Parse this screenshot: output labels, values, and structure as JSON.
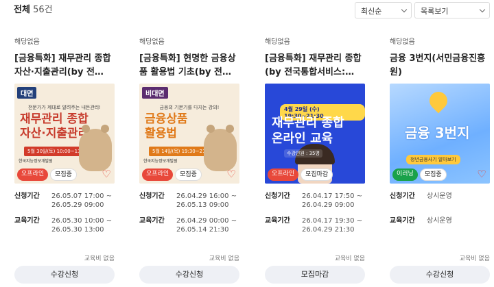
{
  "header": {
    "total_label": "전체",
    "total_count": "56건",
    "sort_select": "최신순",
    "view_select": "목록보기"
  },
  "cards": [
    {
      "status": "해당없음",
      "title": "[금융특화] 재무관리 종합 자산·지출관리(by 전…",
      "thumb": {
        "tag": "대면",
        "subtitle": "전문가가 제대로 알려주는 내돈관리!",
        "headline_1": "재무관리 종합",
        "headline_2": "자산·지출관리",
        "date": "5월 30일(토) 10:00~13:00",
        "logos": "한국지능정보개발원"
      },
      "pills": [
        "오프라인",
        "모집중"
      ],
      "apply_period_label": "신청기간",
      "apply_period": [
        "26.05.07 17:00 ~",
        "26.05.29 09:00"
      ],
      "edu_period_label": "교육기간",
      "edu_period": [
        "26.05.30 10:00 ~",
        "26.05.30 13:00"
      ],
      "fee": "교육비 없음",
      "button": "수강신청"
    },
    {
      "status": "해당없음",
      "title": "[금융특화] 현명한 금융상품 활용법 기초(by 전…",
      "thumb": {
        "tag": "비대면",
        "subtitle": "금융의 기본기를 다지는 강의!",
        "headline_1": "금융상품",
        "headline_2": "활용법",
        "date": "5월 14일(목) 19:30~21:30",
        "logos": "한국지능정보개발원"
      },
      "pills": [
        "오프라인",
        "모집중"
      ],
      "apply_period_label": "신청기간",
      "apply_period": [
        "26.04.29 16:00 ~",
        "26.05.13 09:00"
      ],
      "edu_period_label": "교육기간",
      "edu_period": [
        "26.04.29 00:00 ~",
        "26.05.14 21:30"
      ],
      "fee": "교육비 없음",
      "button": "수강신청"
    },
    {
      "status": "해당없음",
      "title": "[금융특화] 재무관리 종합 (by 전국통합서비스:…",
      "thumb": {
        "banner": "4월 29일 (수) 19:30~21:30",
        "headline_1": "재무관리 종합",
        "headline_2": "온라인 교육",
        "count": "수강인원 : 35명"
      },
      "pills": [
        "오프라인",
        "모집마감"
      ],
      "apply_period_label": "신청기간",
      "apply_period": [
        "26.04.17 17:50 ~",
        "26.04.29 09:00"
      ],
      "edu_period_label": "교육기간",
      "edu_period": [
        "26.04.17 19:30 ~",
        "26.04.29 21:30"
      ],
      "fee": "교육비 없음",
      "button": "모집마감"
    },
    {
      "status": "해당없음",
      "title": "금융 3번지(서민금융진흥원)",
      "thumb": {
        "headline_1": "금융 3번지",
        "bar": "청년금융사기 알아보기"
      },
      "pills": [
        "이러닝",
        "모집중"
      ],
      "apply_period_label": "신청기간",
      "apply_period": [
        "상시운영"
      ],
      "edu_period_label": "교육기간",
      "edu_period": [
        "상시운영"
      ],
      "fee": "교육비 없음",
      "button": "수강신청"
    }
  ]
}
